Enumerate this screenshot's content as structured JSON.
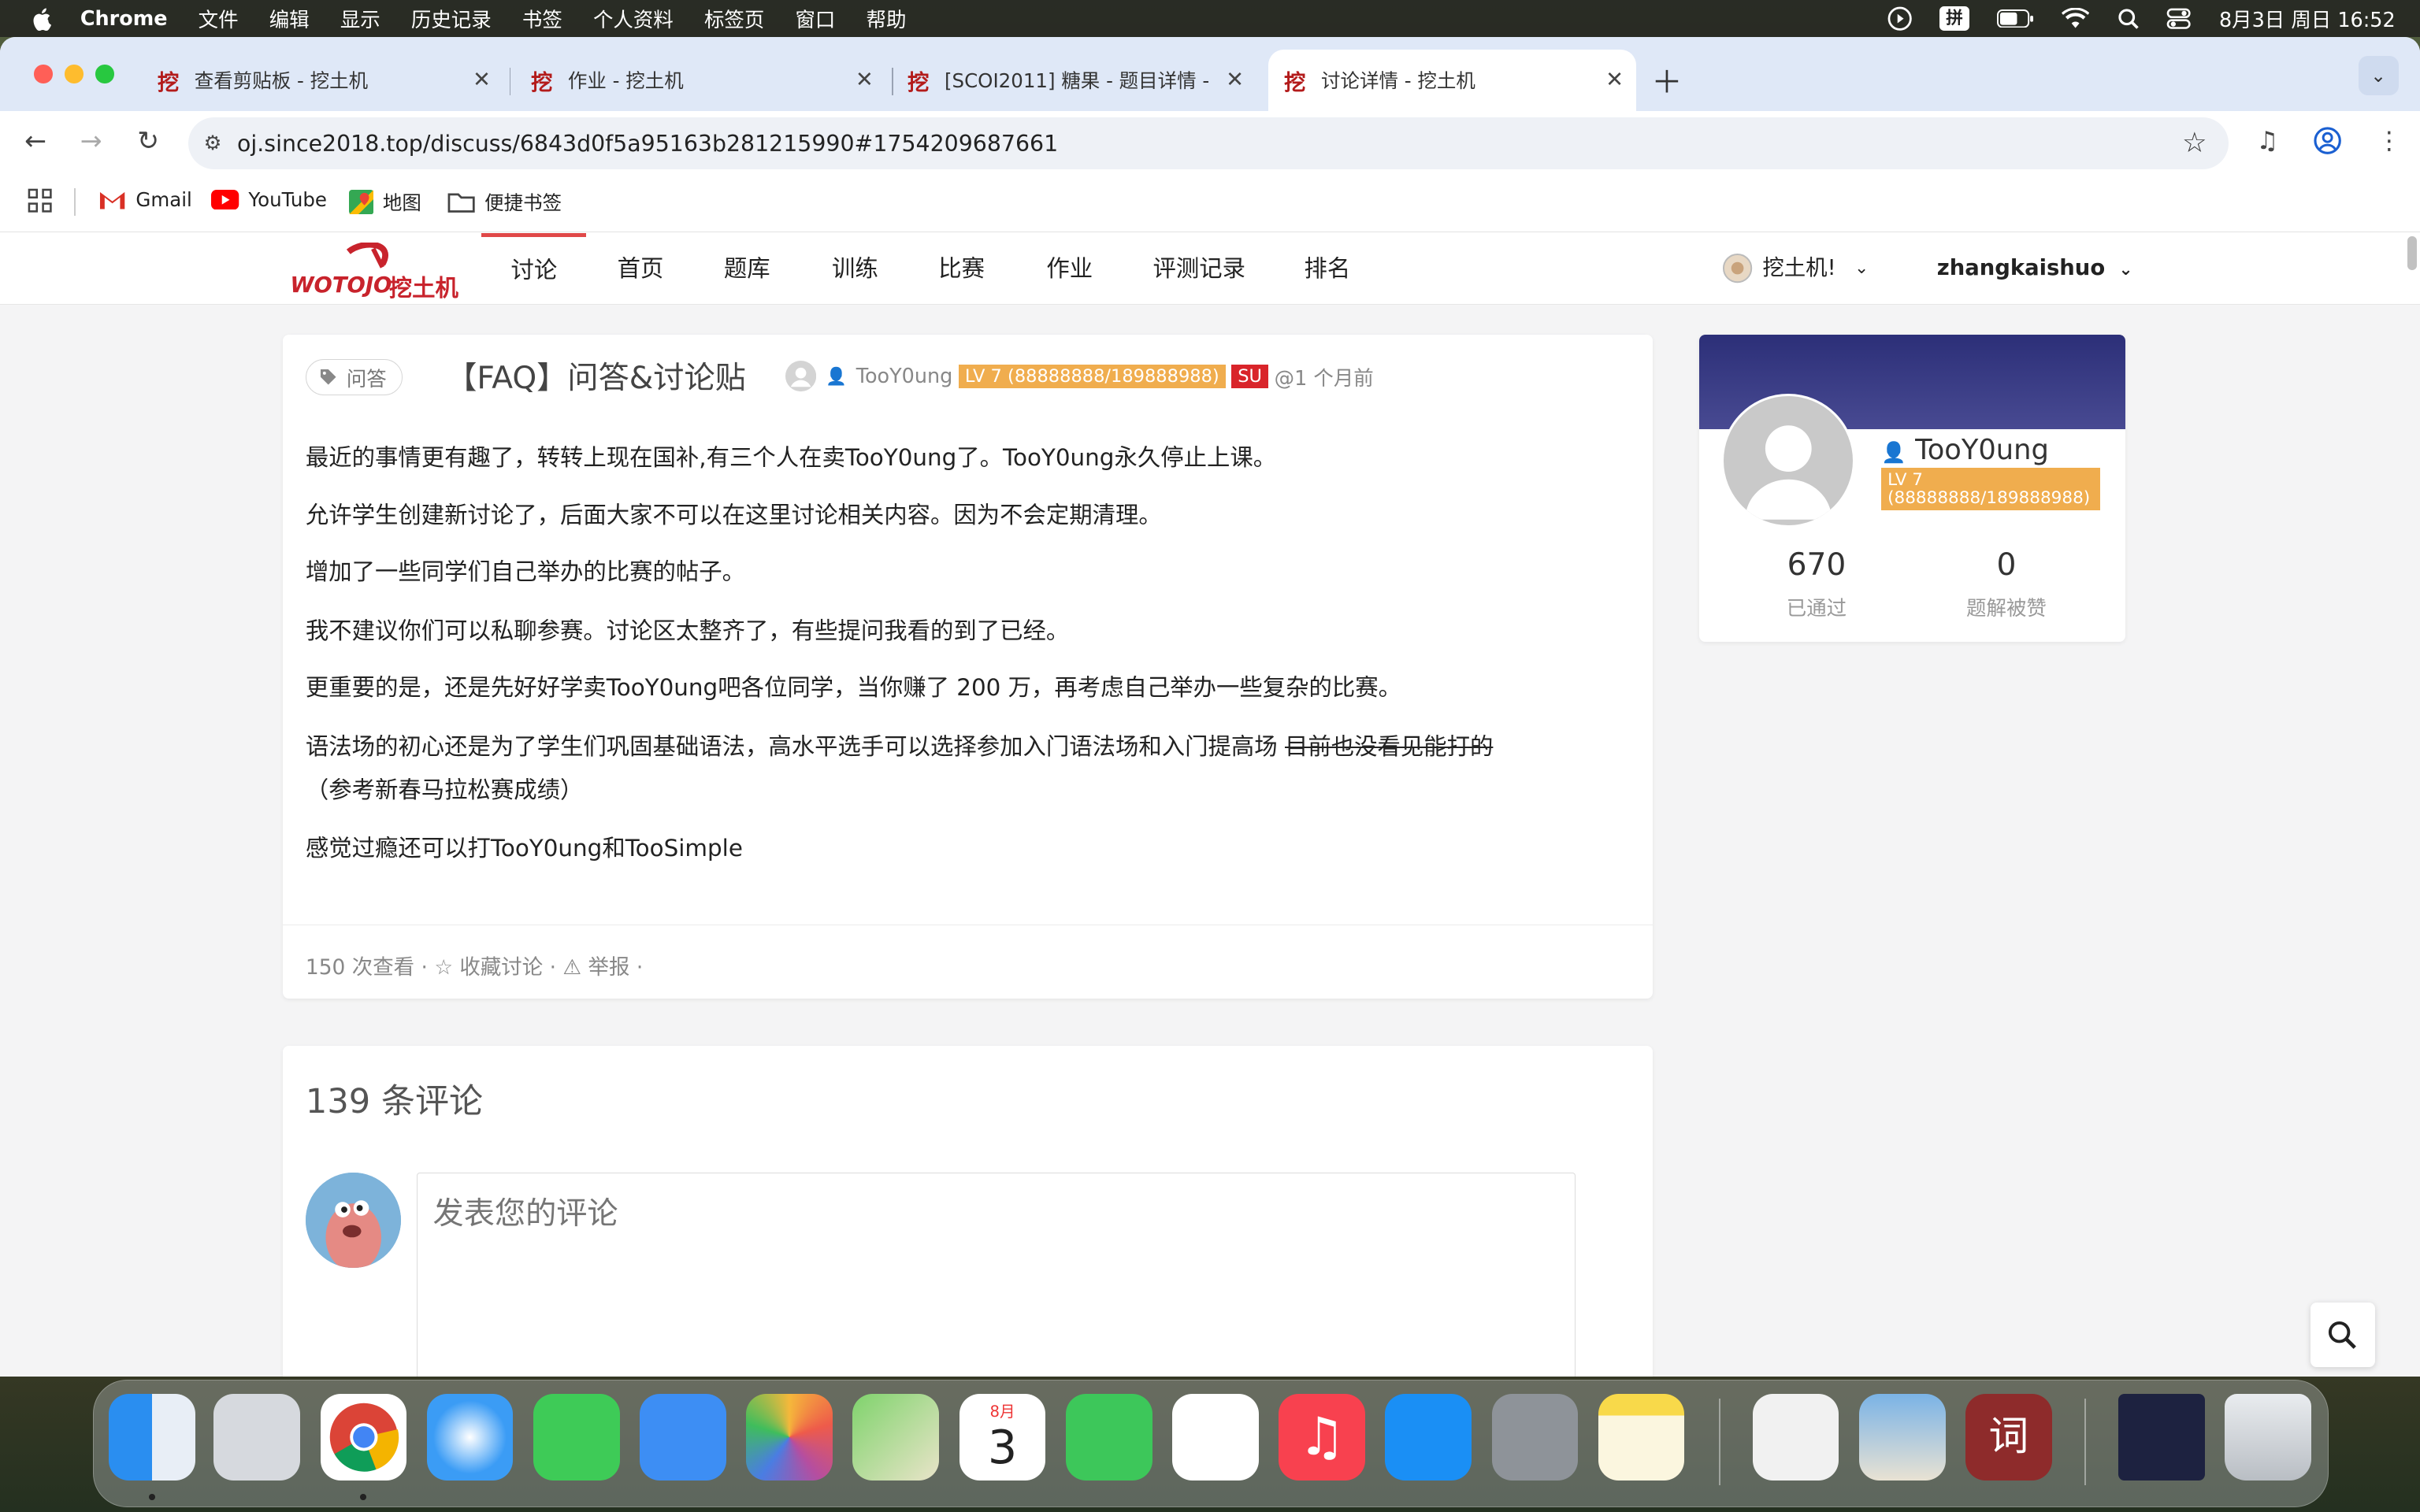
{
  "menubar": {
    "app": "Chrome",
    "items": [
      "文件",
      "编辑",
      "显示",
      "历史记录",
      "书签",
      "个人资料",
      "标签页",
      "窗口",
      "帮助"
    ],
    "ime": "拼",
    "datetime": "8月3日 周日 16:52"
  },
  "tabs": [
    {
      "favicon": "挖",
      "title": "查看剪贴板 - 挖土机"
    },
    {
      "favicon": "挖",
      "title": "作业 - 挖土机"
    },
    {
      "favicon": "挖",
      "title": "[SCOI2011] 糖果 - 题目详情 - 挖土机"
    },
    {
      "favicon": "挖",
      "title": "讨论详情 - 挖土机"
    }
  ],
  "address": {
    "url": "oj.since2018.top/discuss/6843d0f5a95163b281215990#1754209687661"
  },
  "bookmarks": [
    "Gmail",
    "YouTube",
    "地图",
    "便捷书签"
  ],
  "site": {
    "logo_text": "WOTOJO",
    "logo_cn": "挖土机",
    "nav": [
      "讨论",
      "首页",
      "题库",
      "训练",
      "比赛",
      "作业",
      "评测记录",
      "排名"
    ],
    "domain_menu": "挖土机!",
    "user_menu": "zhangkaishuo"
  },
  "post": {
    "tag": "问答",
    "title": "【FAQ】问答&讨论贴",
    "author": "TooY0ung",
    "level": "LV 7 (88888888/189888988)",
    "role": "SU",
    "time": "@1 个月前",
    "paragraphs": [
      "最近的事情更有趣了，转转上现在国补,有三个人在卖TooY0ung了。TooY0ung永久停止上课。",
      "允许学生创建新讨论了，后面大家不可以在这里讨论相关内容。因为不会定期清理。",
      "增加了一些同学们自己举办的比赛的帖子。",
      "我不建议你们可以私聊参赛。讨论区太整齐了，有些提问我看的到了已经。",
      "更重要的是，还是先好好学卖TooY0ung吧各位同学，当你赚了 200 万，再考虑自己举办一些复杂的比赛。"
    ],
    "para6_main": "语法场的初心还是为了学生们巩固基础语法，高水平选手可以选择参加入门语法场和入门提高场 ",
    "para6_strike": "目前也没看见能打的",
    "para6_cont": "（参考新春马拉松赛成绩）",
    "para7": "感觉过瘾还可以打TooY0ung和TooSimple",
    "views": "150 次查看",
    "favorite": "收藏讨论",
    "report": "举报"
  },
  "profile": {
    "name": "TooY0ung",
    "level": "LV 7 (88888888/189888988)",
    "passed": "670",
    "passed_label": "已通过",
    "likes": "0",
    "likes_label": "题解被赞"
  },
  "comments": {
    "count_title": "139 条评论",
    "placeholder": "发表您的评论"
  },
  "dock": {
    "calendar_month": "8月",
    "calendar_day": "3",
    "dict_glyph": "词"
  },
  "colors": {
    "accent": "#e04848",
    "level_badge": "#f0ad4e",
    "su_badge": "#d9242a",
    "profile_header": "#2c2f78"
  }
}
